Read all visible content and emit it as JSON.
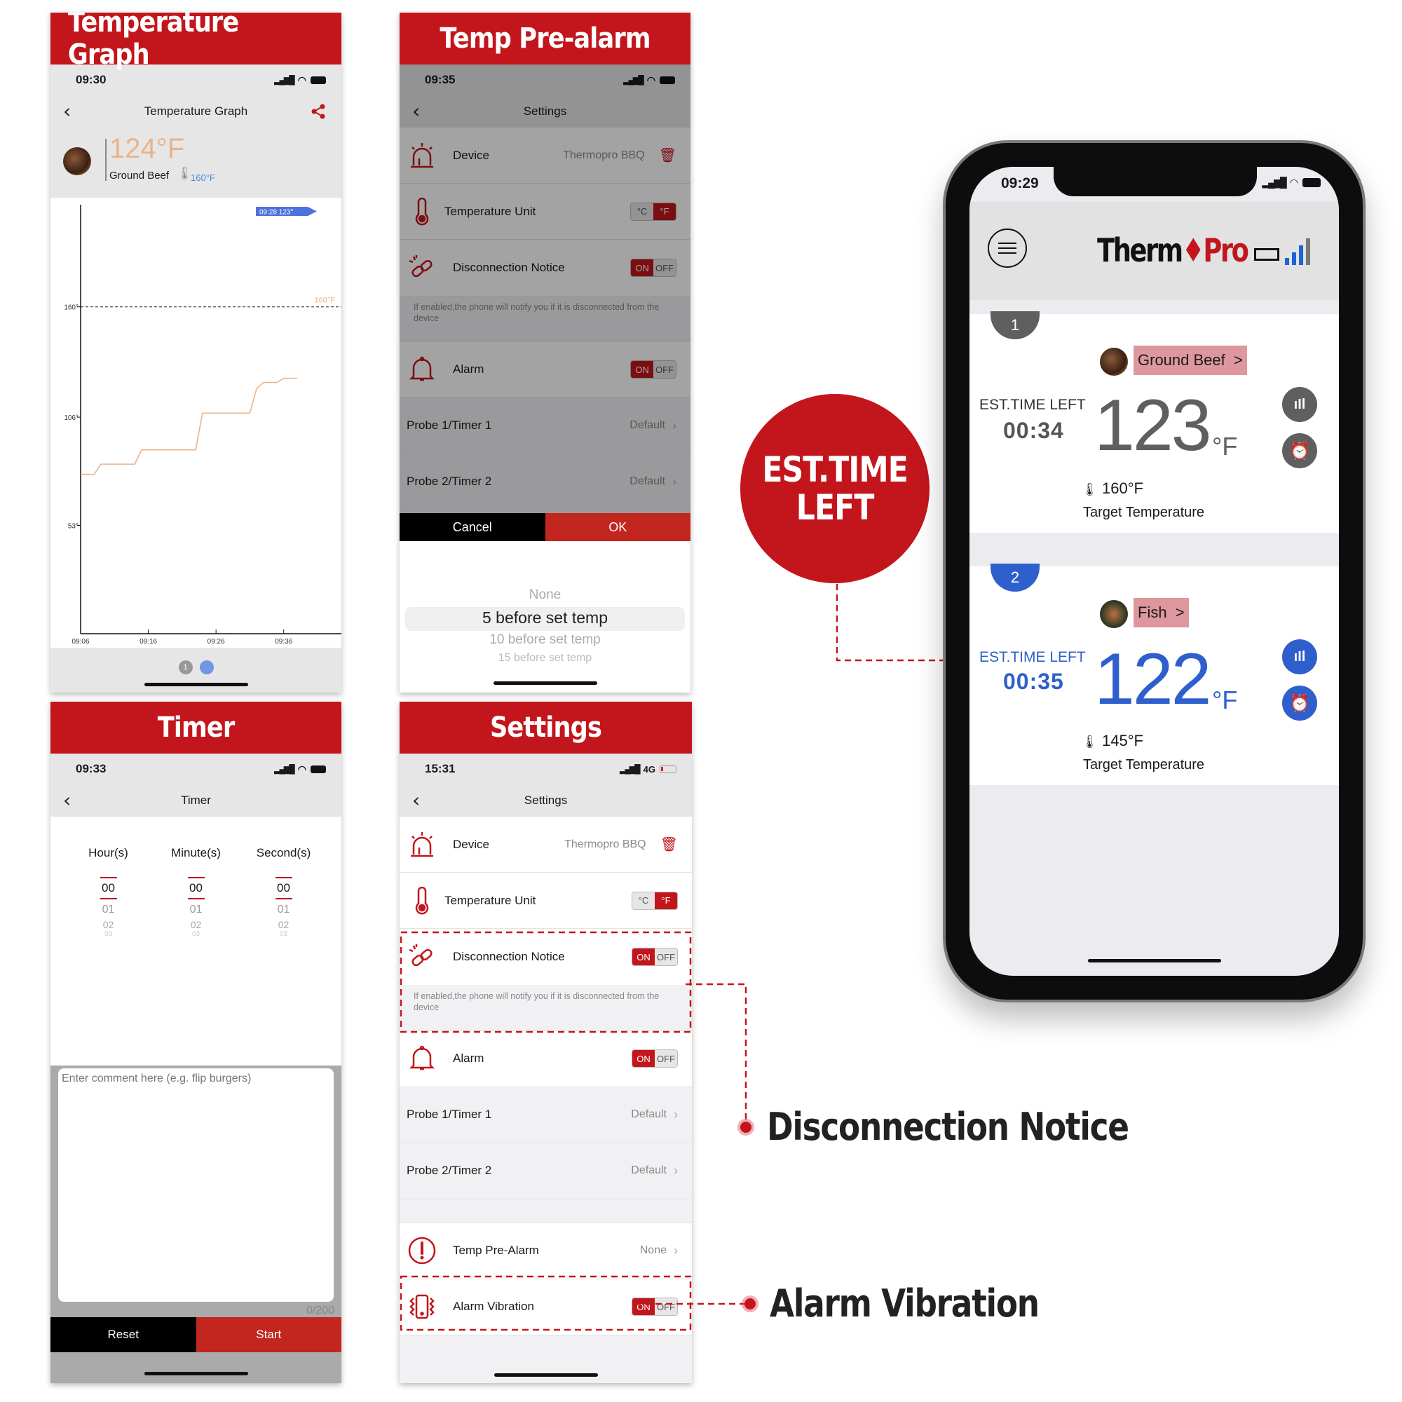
{
  "colors": {
    "brand_red": "#c3161c",
    "probe1_gray": "#5f5f5f",
    "probe2_blue": "#2f5fcc",
    "graph_line": "#eab38a"
  },
  "panels": {
    "graph": {
      "header": "Temperature Graph",
      "status_time": "09:30",
      "nav_title": "Temperature Graph",
      "current_temp": "124°F",
      "food": "Ground Beef",
      "target": "160°F",
      "tooltip": "09:28  123°",
      "target_line_label": "160°F",
      "page_dot_label": "1"
    },
    "prealarm": {
      "header": "Temp Pre-alarm",
      "status_time": "09:35",
      "nav_title": "Settings",
      "rows": {
        "device_label": "Device",
        "device_value": "Thermopro BBQ",
        "unit_label": "Temperature Unit",
        "unit_c": "°C",
        "unit_f": "°F",
        "disc_label": "Disconnection Notice",
        "on": "ON",
        "off": "OFF",
        "disc_note": "If enabled,the phone will notify you if it is disconnected from the device",
        "alarm_label": "Alarm",
        "probe1_label": "Probe 1/Timer 1",
        "probe2_label": "Probe 2/Timer 2",
        "default": "Default"
      },
      "cancel": "Cancel",
      "ok": "OK",
      "picker": [
        "None",
        "5 before set temp",
        "10 before set temp",
        "15 before set temp"
      ],
      "picker_selected": "5 before set temp"
    },
    "timer": {
      "header": "Timer",
      "status_time": "09:33",
      "nav_title": "Timer",
      "columns": [
        {
          "label": "Hour(s)",
          "values": [
            "00",
            "01",
            "02",
            "03"
          ]
        },
        {
          "label": "Minute(s)",
          "values": [
            "00",
            "01",
            "02",
            "03"
          ]
        },
        {
          "label": "Second(s)",
          "values": [
            "00",
            "01",
            "02",
            "03"
          ]
        }
      ],
      "comment_placeholder": "Enter comment here (e.g. flip burgers)",
      "counter": "0/200",
      "reset": "Reset",
      "start": "Start"
    },
    "settings": {
      "header": "Settings",
      "status_time": "15:31",
      "network": "4G",
      "nav_title": "Settings",
      "rows": {
        "device_label": "Device",
        "device_value": "Thermopro BBQ",
        "unit_label": "Temperature Unit",
        "unit_c": "°C",
        "unit_f": "°F",
        "disc_label": "Disconnection Notice",
        "on": "ON",
        "off": "OFF",
        "disc_note": "If enabled,the phone will notify you if it is disconnected from the device",
        "alarm_label": "Alarm",
        "probe1_label": "Probe 1/Timer 1",
        "probe2_label": "Probe 2/Timer 2",
        "default": "Default",
        "prealarm_label": "Temp Pre-Alarm",
        "prealarm_value": "None",
        "vibration_label": "Alarm Vibration"
      }
    }
  },
  "phone": {
    "status_time": "09:29",
    "logo_left": "Therm",
    "logo_right": "Pro",
    "probes": [
      {
        "number": "1",
        "food": "Ground Beef  >",
        "est_label": "EST.TIME LEFT",
        "est_time": "00:34",
        "temp": "123",
        "unit": "°F",
        "target": "160°F",
        "target_label": "Target Temperature"
      },
      {
        "number": "2",
        "food": "Fish  >",
        "est_label": "EST.TIME LEFT",
        "est_time": "00:35",
        "temp": "122",
        "unit": "°F",
        "target": "145°F",
        "target_label": "Target Temperature"
      }
    ]
  },
  "callouts": {
    "est_time_line1": "EST.TIME",
    "est_time_line2": "LEFT",
    "disconnection": "Disconnection Notice",
    "vibration": "Alarm Vibration"
  },
  "chart_data": {
    "type": "line",
    "title": "Temperature Graph",
    "xlabel": "",
    "ylabel": "",
    "x_ticks": [
      "09:06",
      "09:16",
      "09:26",
      "09:36"
    ],
    "y_ticks": [
      53,
      106,
      160
    ],
    "ylim": [
      0,
      210
    ],
    "xlim_minutes": [
      0,
      38
    ],
    "target_line": {
      "value": 160,
      "label": "160°F"
    },
    "tooltip": {
      "time": "09:28",
      "value": 123
    },
    "series": [
      {
        "name": "Ground Beef",
        "x_minutes": [
          0,
          2,
          3,
          8,
          9,
          17,
          18,
          25,
          26,
          27,
          29,
          30,
          32
        ],
        "values": [
          78,
          78,
          83,
          83,
          90,
          90,
          108,
          108,
          120,
          123,
          123,
          125,
          125
        ]
      }
    ]
  }
}
